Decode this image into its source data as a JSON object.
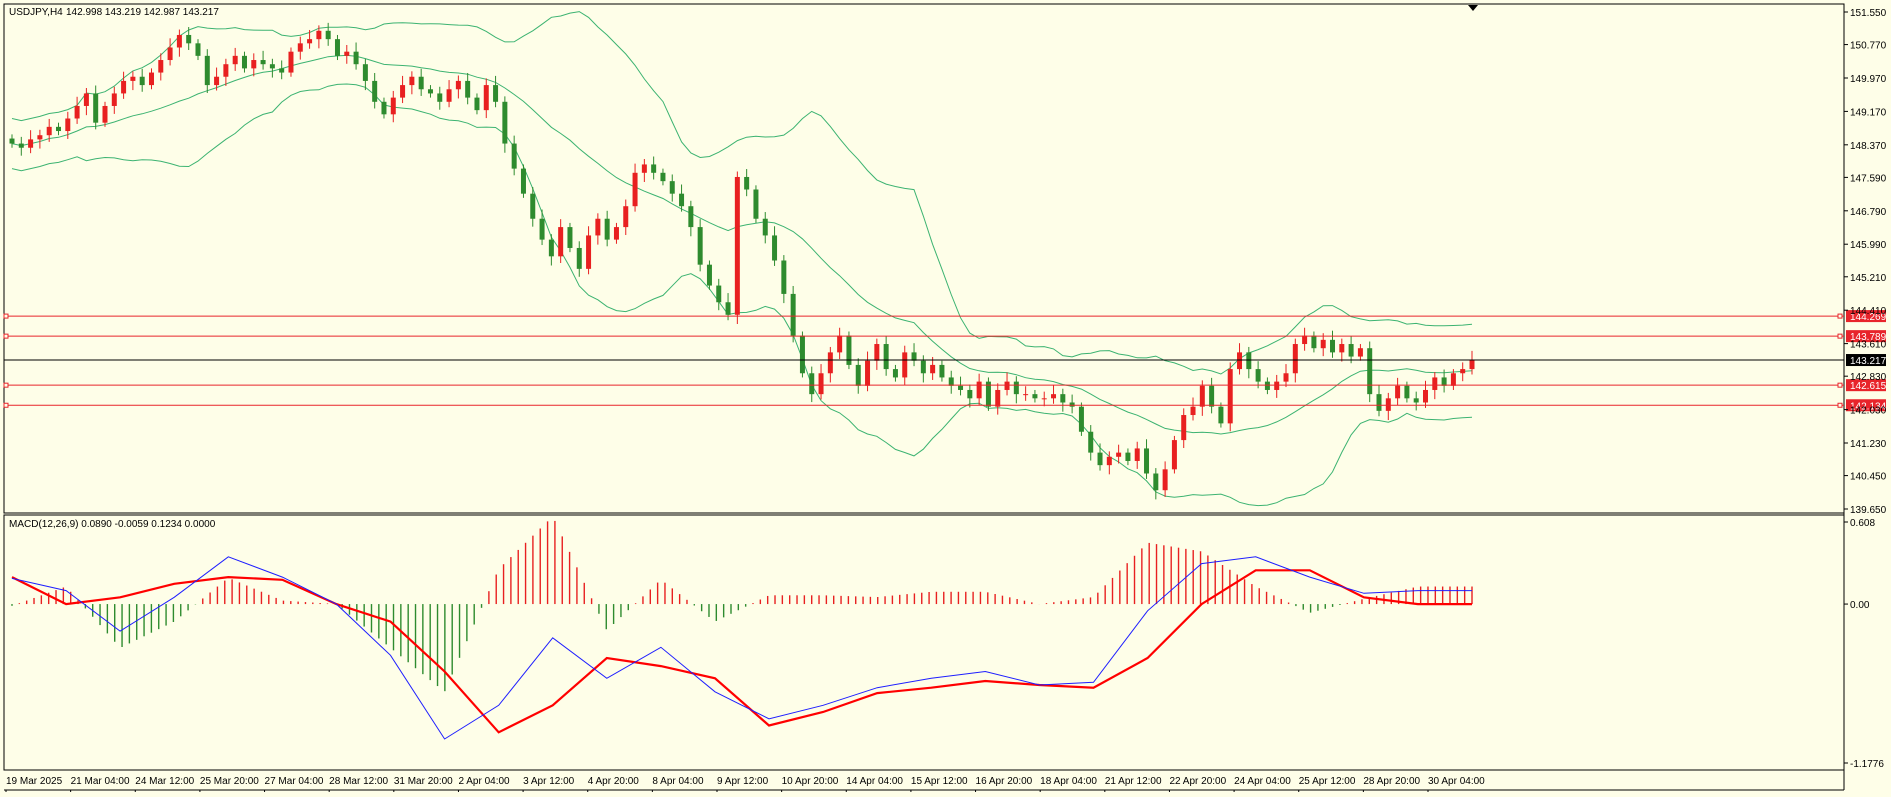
{
  "header": {
    "symbol": "USDJPY,H4",
    "ohlc": "142.998 143.219 142.987 143.217",
    "macd_label": "MACD(12,26,9) 0.0890 -0.0059 0.1234 0.0000"
  },
  "colors": {
    "background": "#fefee8",
    "bull": "#e82020",
    "bear": "#2e8b2e",
    "bands": "#3cb371",
    "level_line": "#e8242b",
    "current_line": "#000000",
    "macd_line": "#1e1eff",
    "signal_line": "#ff0000"
  },
  "chart_data": [
    {
      "type": "candlestick",
      "title": "USDJPY,H4",
      "ylim": [
        139.65,
        151.55
      ],
      "y_ticks": [
        "151.550",
        "150.770",
        "149.970",
        "149.170",
        "148.370",
        "147.590",
        "146.790",
        "145.990",
        "145.210",
        "144.410",
        "143.610",
        "142.830",
        "142.030",
        "141.230",
        "140.450",
        "139.650"
      ],
      "x_labels": [
        "19 Mar 2025",
        "21 Mar 04:00",
        "24 Mar 12:00",
        "25 Mar 20:00",
        "27 Mar 04:00",
        "28 Mar 12:00",
        "31 Mar 20:00",
        "2 Apr 04:00",
        "3 Apr 12:00",
        "4 Apr 20:00",
        "8 Apr 04:00",
        "9 Apr 12:00",
        "10 Apr 20:00",
        "14 Apr 04:00",
        "15 Apr 12:00",
        "16 Apr 20:00",
        "18 Apr 04:00",
        "21 Apr 12:00",
        "22 Apr 20:00",
        "24 Apr 04:00",
        "25 Apr 12:00",
        "28 Apr 20:00",
        "30 Apr 04:00"
      ],
      "price_levels": [
        {
          "value": 144.269,
          "label": "144.269"
        },
        {
          "value": 143.789,
          "label": "143.789"
        },
        {
          "value": 142.615,
          "label": "142.615"
        },
        {
          "value": 142.134,
          "label": "142.134"
        }
      ],
      "current_price": {
        "value": 143.217,
        "label": "143.217"
      },
      "closes": [
        148.4,
        148.3,
        148.5,
        148.6,
        148.8,
        148.7,
        149.0,
        149.3,
        149.6,
        148.9,
        149.3,
        149.6,
        149.9,
        150.0,
        149.8,
        150.1,
        150.4,
        150.7,
        151.0,
        150.8,
        150.5,
        149.8,
        150.0,
        150.3,
        150.5,
        150.2,
        150.4,
        150.3,
        150.2,
        150.1,
        150.6,
        150.8,
        150.9,
        151.1,
        150.9,
        150.5,
        150.6,
        150.3,
        149.9,
        149.4,
        149.1,
        149.5,
        149.8,
        150.0,
        149.7,
        149.6,
        149.4,
        149.7,
        149.9,
        149.5,
        149.2,
        149.8,
        149.4,
        148.4,
        147.8,
        147.2,
        146.6,
        146.1,
        145.7,
        146.4,
        145.9,
        145.4,
        146.2,
        146.6,
        146.1,
        146.4,
        146.9,
        147.7,
        147.9,
        147.7,
        147.5,
        147.2,
        146.9,
        146.4,
        145.5,
        145.0,
        144.6,
        144.3,
        147.6,
        147.3,
        146.6,
        146.2,
        145.6,
        144.8,
        143.8,
        142.9,
        142.4,
        142.9,
        143.4,
        143.8,
        143.1,
        142.6,
        143.2,
        143.6,
        143.0,
        142.8,
        143.4,
        143.2,
        142.9,
        143.1,
        142.8,
        142.6,
        142.5,
        142.3,
        142.7,
        142.1,
        142.5,
        142.7,
        142.4,
        142.4,
        142.3,
        142.3,
        142.4,
        142.2,
        142.1,
        141.5,
        141.0,
        140.7,
        140.9,
        141.0,
        140.8,
        141.1,
        140.5,
        140.1,
        140.6,
        141.3,
        141.9,
        142.1,
        142.6,
        142.1,
        141.7,
        143.0,
        143.4,
        143.0,
        142.7,
        142.5,
        142.7,
        142.9,
        143.6,
        143.8,
        143.5,
        143.7,
        143.4,
        143.6,
        143.3,
        143.5,
        142.4,
        142.0,
        142.3,
        142.6,
        142.3,
        142.2,
        142.5,
        142.8,
        142.6,
        142.9,
        143.0,
        143.217
      ]
    },
    {
      "type": "macd",
      "title": "MACD(12,26,9) 0.0890 -0.0059 0.1234 0.0000",
      "ylim": [
        -1.1776,
        0.608
      ],
      "y_ticks": [
        "0.608",
        "0.00",
        "-1.1776"
      ],
      "series": [
        {
          "name": "MACD",
          "values": [
            0.19,
            0.1,
            -0.2,
            0.05,
            0.35,
            0.2,
            0.0,
            -0.38,
            -1.0,
            -0.75,
            -0.25,
            -0.55,
            -0.32,
            -0.65,
            -0.85,
            -0.75,
            -0.62,
            -0.55,
            -0.5,
            -0.6,
            -0.58,
            -0.05,
            0.3,
            0.35,
            0.2,
            0.08,
            0.1,
            0.1
          ]
        },
        {
          "name": "Signal",
          "values": [
            0.2,
            0.0,
            0.05,
            0.15,
            0.2,
            0.18,
            0.0,
            -0.13,
            -0.5,
            -0.95,
            -0.75,
            -0.4,
            -0.46,
            -0.55,
            -0.9,
            -0.8,
            -0.66,
            -0.62,
            -0.57,
            -0.6,
            -0.62,
            -0.4,
            0.0,
            0.25,
            0.25,
            0.05,
            0.0,
            0.0
          ]
        }
      ]
    }
  ]
}
